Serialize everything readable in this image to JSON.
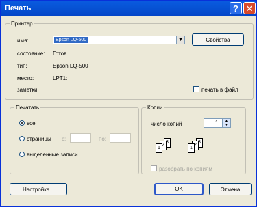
{
  "window": {
    "title": "Печать",
    "help_glyph": "?",
    "close_glyph": "✕"
  },
  "printer": {
    "legend": "Принтер",
    "name_label": "имя:",
    "name_value": "Epson LQ-500",
    "properties_button": "Свойства",
    "status_label": "состояние:",
    "status_value": "Готов",
    "type_label": "тип:",
    "type_value": "Epson LQ-500",
    "location_label": "место:",
    "location_value": "LPT1:",
    "comment_label": "заметки:",
    "print_to_file": "печать в файл"
  },
  "range": {
    "legend": "Печатать",
    "all": "все",
    "pages": "страницы",
    "from": "с:",
    "to": "по:",
    "selection": "выделенные записи"
  },
  "copies": {
    "legend": "Копии",
    "count_label": "число копий",
    "count_value": "1",
    "collate": "разобрать по копиям",
    "page_numbers": [
      "1",
      "2",
      "3"
    ]
  },
  "buttons": {
    "setup": "Настройка...",
    "ok": "OK",
    "cancel": "Отмена"
  },
  "icons": {
    "help": "help-icon",
    "close": "close-icon",
    "dropdown": "chevron-down-icon"
  }
}
